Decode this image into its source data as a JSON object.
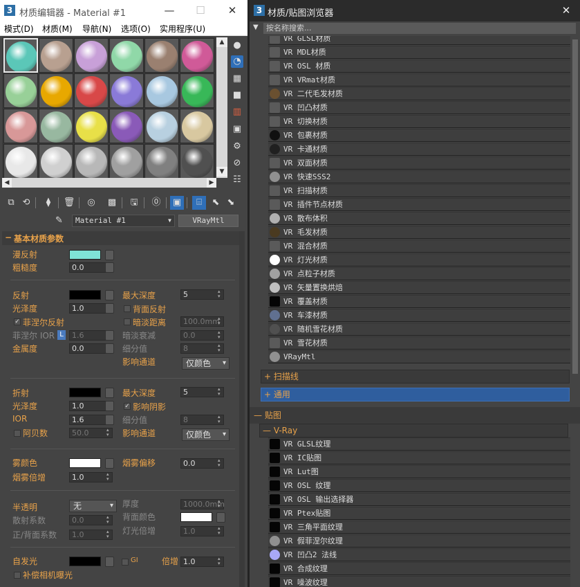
{
  "editor": {
    "icon": "3",
    "title": "材质编辑器 - Material #1",
    "window_buttons": {
      "minimize": "—",
      "maximize": "☐",
      "close": "✕"
    },
    "menus": [
      "模式(D)",
      "材质(M)",
      "导航(N)",
      "选项(O)",
      "实用程序(U)"
    ],
    "slot_colors": [
      "#5bc7b8",
      "#b8a090",
      "#c8a0d8",
      "#90d8a8",
      "#9a8070",
      "#d05a98",
      "#98d098",
      "#e8a800",
      "#d84848",
      "#8a7ad8",
      "#a8c8e0",
      "#38b858",
      "#d89898",
      "#98b8a0",
      "#e8e048",
      "#8a5ab8",
      "#b8d0e0",
      "#d8c8a0",
      "#e8e8e8",
      "#d0d0d0",
      "#b8b8b8",
      "#a0a0a0",
      "#808080",
      "#505050"
    ],
    "material_name": "Material #1",
    "material_type": "VRayMtl"
  },
  "params": {
    "rollout_title": "基本材质参数",
    "diffuse": "漫反射",
    "diffuse_color": "#7fe3d6",
    "roughness": "粗糙度",
    "roughness_value": "0.0",
    "reflect": "反射",
    "max_depth": "最大深度",
    "reflect_max_depth": "5",
    "glossiness": "光泽度",
    "reflect_gloss": "1.0",
    "back_reflect": "背面反射",
    "fresnel": "菲涅尔反射",
    "dim_distance": "暗淡距离",
    "dim_distance_value": "100.0mm",
    "fresnel_ior": "菲涅尔 IOR",
    "lock_glyph": "L",
    "fresnel_ior_value": "1.6",
    "dim_falloff": "暗淡衰减",
    "dim_falloff_value": "0.0",
    "metalness": "金属度",
    "metalness_value": "0.0",
    "subdivs": "细分值",
    "subdivs_value": "8",
    "affect_channels": "影响通道",
    "color_only": "仅颜色",
    "refract": "折射",
    "refract_max_depth": "5",
    "refract_gloss": "1.0",
    "affect_shadows": "影响阴影",
    "ior": "IOR",
    "ior_value": "1.6",
    "refract_subdivs": "8",
    "abbe": "阿贝数",
    "abbe_value": "50.0",
    "fog_color": "雾颜色",
    "fog_bias": "烟雾偏移",
    "fog_bias_value": "0.0",
    "fog_mult": "烟雾倍增",
    "fog_mult_value": "1.0",
    "translucency": "半透明",
    "translucency_value": "无",
    "thickness": "厚度",
    "thickness_value": "1000.0mm",
    "scatter_coeff": "散射系数",
    "scatter_value": "0.0",
    "back_color": "背面颜色",
    "fb_coeff": "正/背面系数",
    "fb_value": "1.0",
    "light_mult": "灯光倍增",
    "light_mult_value": "1.0",
    "self_illum": "自发光",
    "gi": "GI",
    "multiplier": "倍增",
    "self_illum_value": "1.0",
    "compensate": "补偿相机曝光"
  },
  "browser": {
    "icon": "3",
    "title": "材质/贴图浏览器",
    "close": "✕",
    "search_placeholder": "按名称搜索...",
    "materials": [
      {
        "label": "VR GLSL材质",
        "icon": "#5a5a5a"
      },
      {
        "label": "VR MDL材质",
        "icon": "#5a5a5a"
      },
      {
        "label": "VR OSL 材质",
        "icon": "#5a5a5a"
      },
      {
        "label": "VR VRmat材质",
        "icon": "#5a5a5a"
      },
      {
        "label": "VR 二代毛发材质",
        "icon": "#6a5030"
      },
      {
        "label": "VR 凹凸材质",
        "icon": "#5a5a5a"
      },
      {
        "label": "VR 切换材质",
        "icon": "#5a5a5a"
      },
      {
        "label": "VR 包裹材质",
        "icon": "#101010"
      },
      {
        "label": "VR 卡通材质",
        "icon": "#202020"
      },
      {
        "label": "VR 双面材质",
        "icon": "#5a5a5a"
      },
      {
        "label": "VR 快速SSS2",
        "icon": "#909090"
      },
      {
        "label": "VR 扫描材质",
        "icon": "#5a5a5a"
      },
      {
        "label": "VR 插件节点材质",
        "icon": "#5a5a5a"
      },
      {
        "label": "VR 散布体积",
        "icon": "#b0b0b0"
      },
      {
        "label": "VR 毛发材质",
        "icon": "#4a3a20"
      },
      {
        "label": "VR 混合材质",
        "icon": "#5a5a5a"
      },
      {
        "label": "VR 灯光材质",
        "icon": "#ffffff"
      },
      {
        "label": "VR 点粒子材质",
        "icon": "#a0a0a0"
      },
      {
        "label": "VR 矢量置换烘焙",
        "icon": "#c0c0c0"
      },
      {
        "label": "VR 覆盖材质",
        "icon": "#050505"
      },
      {
        "label": "VR 车漆材质",
        "icon": "#607090"
      },
      {
        "label": "VR 随机雪花材质",
        "icon": "#505050"
      },
      {
        "label": "VR 雪花材质",
        "icon": "#5a5a5a"
      },
      {
        "label": "VRayMtl",
        "icon": "#909090"
      }
    ],
    "scanline": "+ 扫描线",
    "general": "+ 通用",
    "maps": "— 贴图",
    "vray": "— V-Ray",
    "maps_list": [
      {
        "label": "VR GLSL纹理",
        "icon": "#050505"
      },
      {
        "label": "VR IC贴图",
        "icon": "#050505"
      },
      {
        "label": "VR Lut图",
        "icon": "#050505"
      },
      {
        "label": "VR OSL 纹理",
        "icon": "#050505"
      },
      {
        "label": "VR OSL 输出选择器",
        "icon": "#050505"
      },
      {
        "label": "VR Ptex贴图",
        "icon": "#050505"
      },
      {
        "label": "VR 三角平面纹理",
        "icon": "#050505"
      },
      {
        "label": "VR 假菲涅尔纹理",
        "icon": "#909090"
      },
      {
        "label": "VR 凹凸2 法线",
        "icon": "#a8a8f8"
      },
      {
        "label": "VR 合成纹理",
        "icon": "#050505"
      },
      {
        "label": "VR 噪波纹理",
        "icon": "#050505"
      }
    ]
  }
}
